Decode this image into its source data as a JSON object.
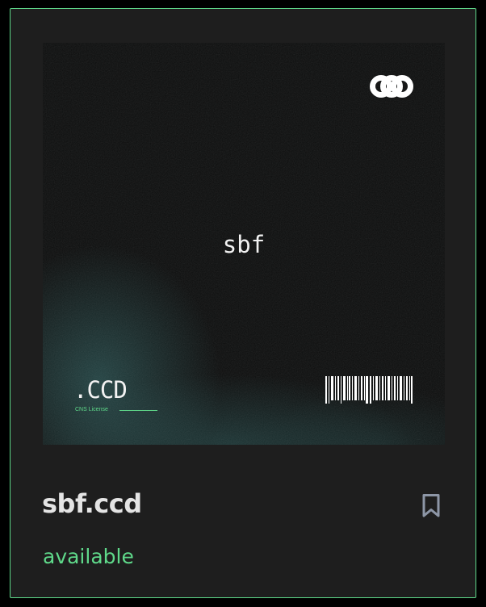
{
  "card": {
    "art": {
      "title": "sbf",
      "tld": ".CCD",
      "license": "CNS License",
      "logo_icon": "triple-ring-logo-icon",
      "barcode_icon": "barcode-icon"
    },
    "domain": "sbf.ccd",
    "status": "available",
    "bookmark_icon": "bookmark-icon"
  },
  "colors": {
    "accent": "#5fd98a",
    "card_bg": "#1e1e1e",
    "art_bg": "#0c0d0d",
    "text_primary": "#e4e4e4",
    "icon_muted": "#8d96a6"
  }
}
